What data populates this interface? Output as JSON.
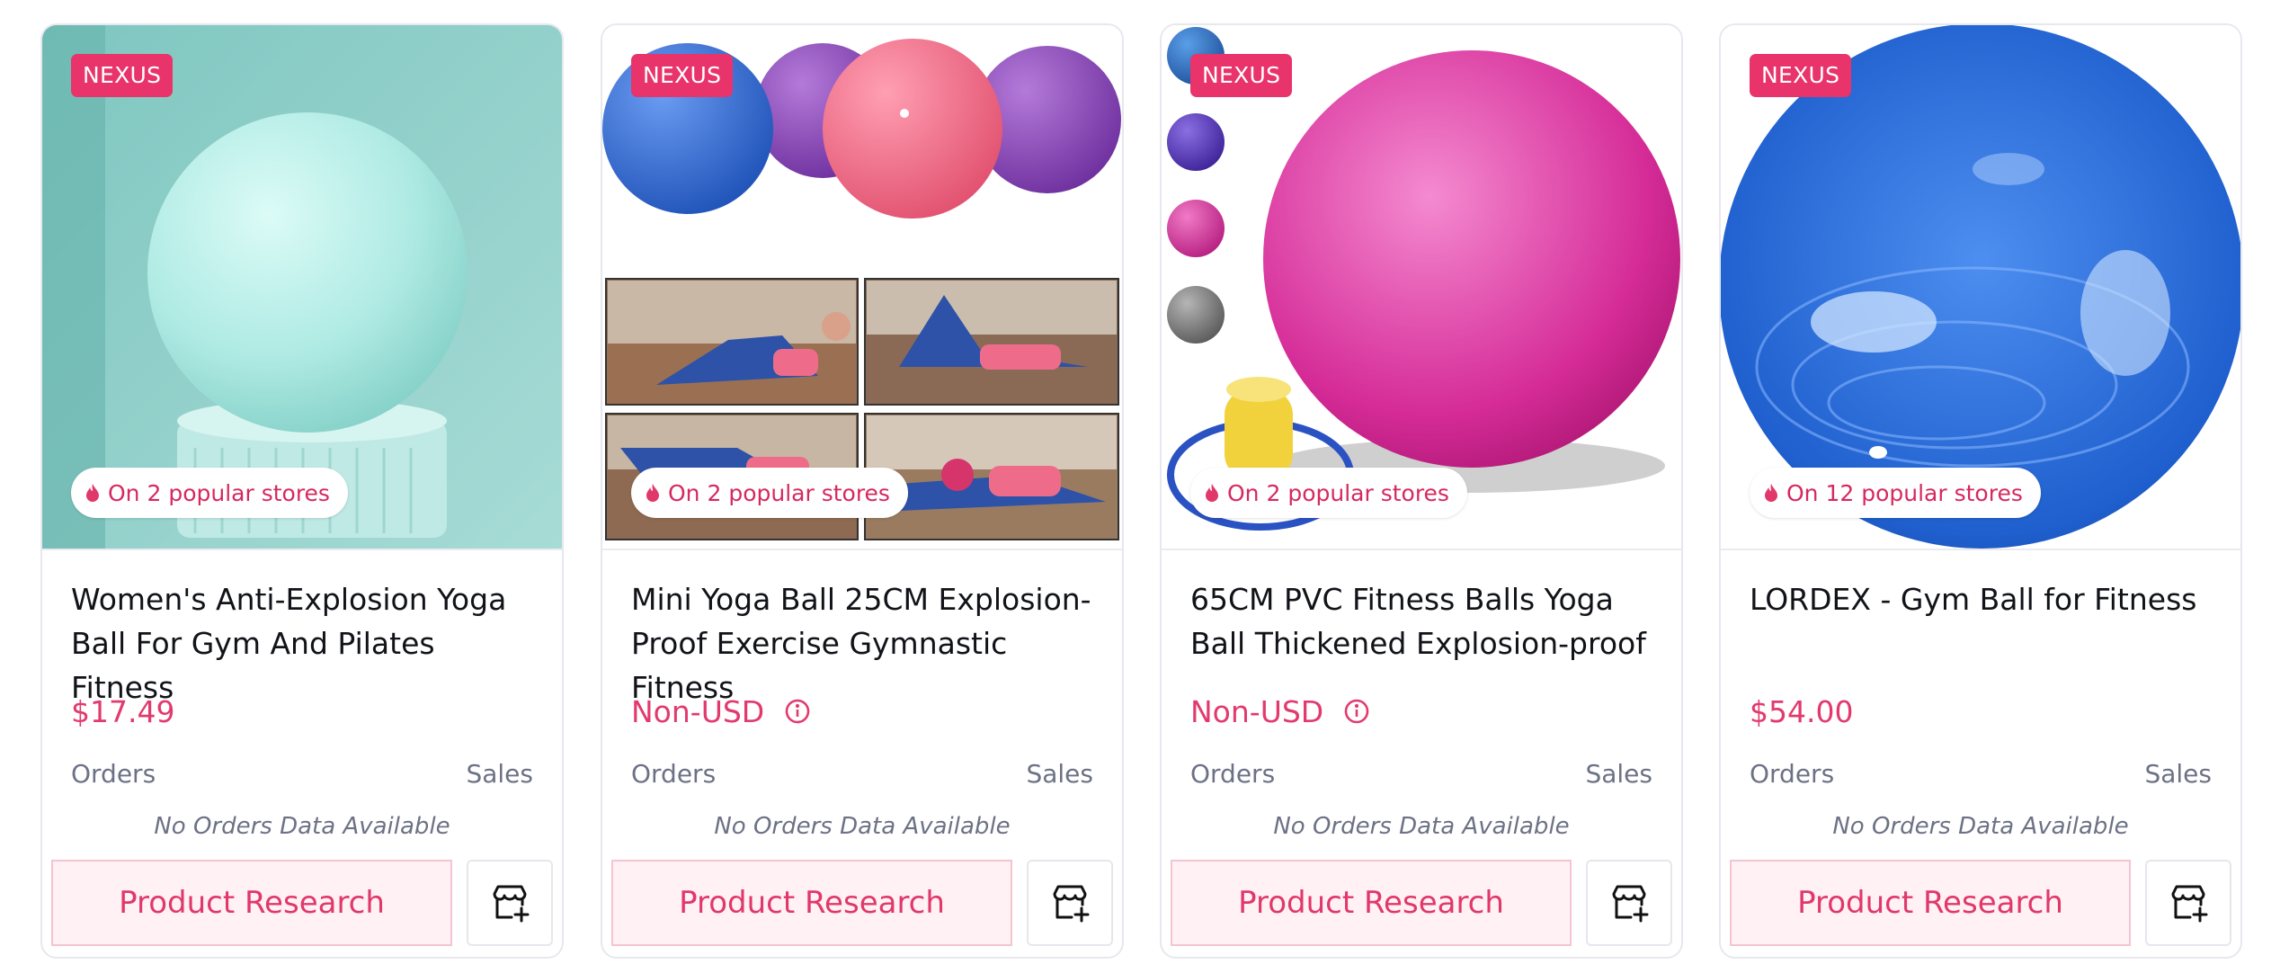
{
  "products": [
    {
      "brand": "NEXUS",
      "popular": "On 2 popular stores",
      "title": "Women's Anti-Explosion Yoga Ball For Gym And Pilates Fitness",
      "price": "$17.49",
      "orders_label": "Orders",
      "sales_label": "Sales",
      "no_data": "No Orders Data Available",
      "research_label": "Product Research"
    },
    {
      "brand": "NEXUS",
      "popular": "On 2 popular stores",
      "title": "Mini Yoga Ball 25CM Explosion-Proof Exercise Gymnastic Fitness",
      "price": "Non-USD",
      "orders_label": "Orders",
      "sales_label": "Sales",
      "no_data": "No Orders Data Available",
      "research_label": "Product Research"
    },
    {
      "brand": "NEXUS",
      "popular": "On 2 popular stores",
      "title": "65CM PVC Fitness Balls Yoga Ball Thickened Explosion-proof",
      "price": "Non-USD",
      "orders_label": "Orders",
      "sales_label": "Sales",
      "no_data": "No Orders Data Available",
      "research_label": "Product Research"
    },
    {
      "brand": "NEXUS",
      "popular": "On 12 popular stores",
      "title": "LORDEX - Gym Ball for Fitness",
      "price": "$54.00",
      "orders_label": "Orders",
      "sales_label": "Sales",
      "no_data": "No Orders Data Available",
      "research_label": "Product Research"
    }
  ],
  "icons": {
    "popular": "fire-icon",
    "price_info": "info-icon",
    "add_store": "store-add-icon"
  },
  "colors": {
    "accent": "#e8336b",
    "price": "#e23a6e",
    "muted": "#6c7285",
    "button_bg": "#fff1f4"
  }
}
